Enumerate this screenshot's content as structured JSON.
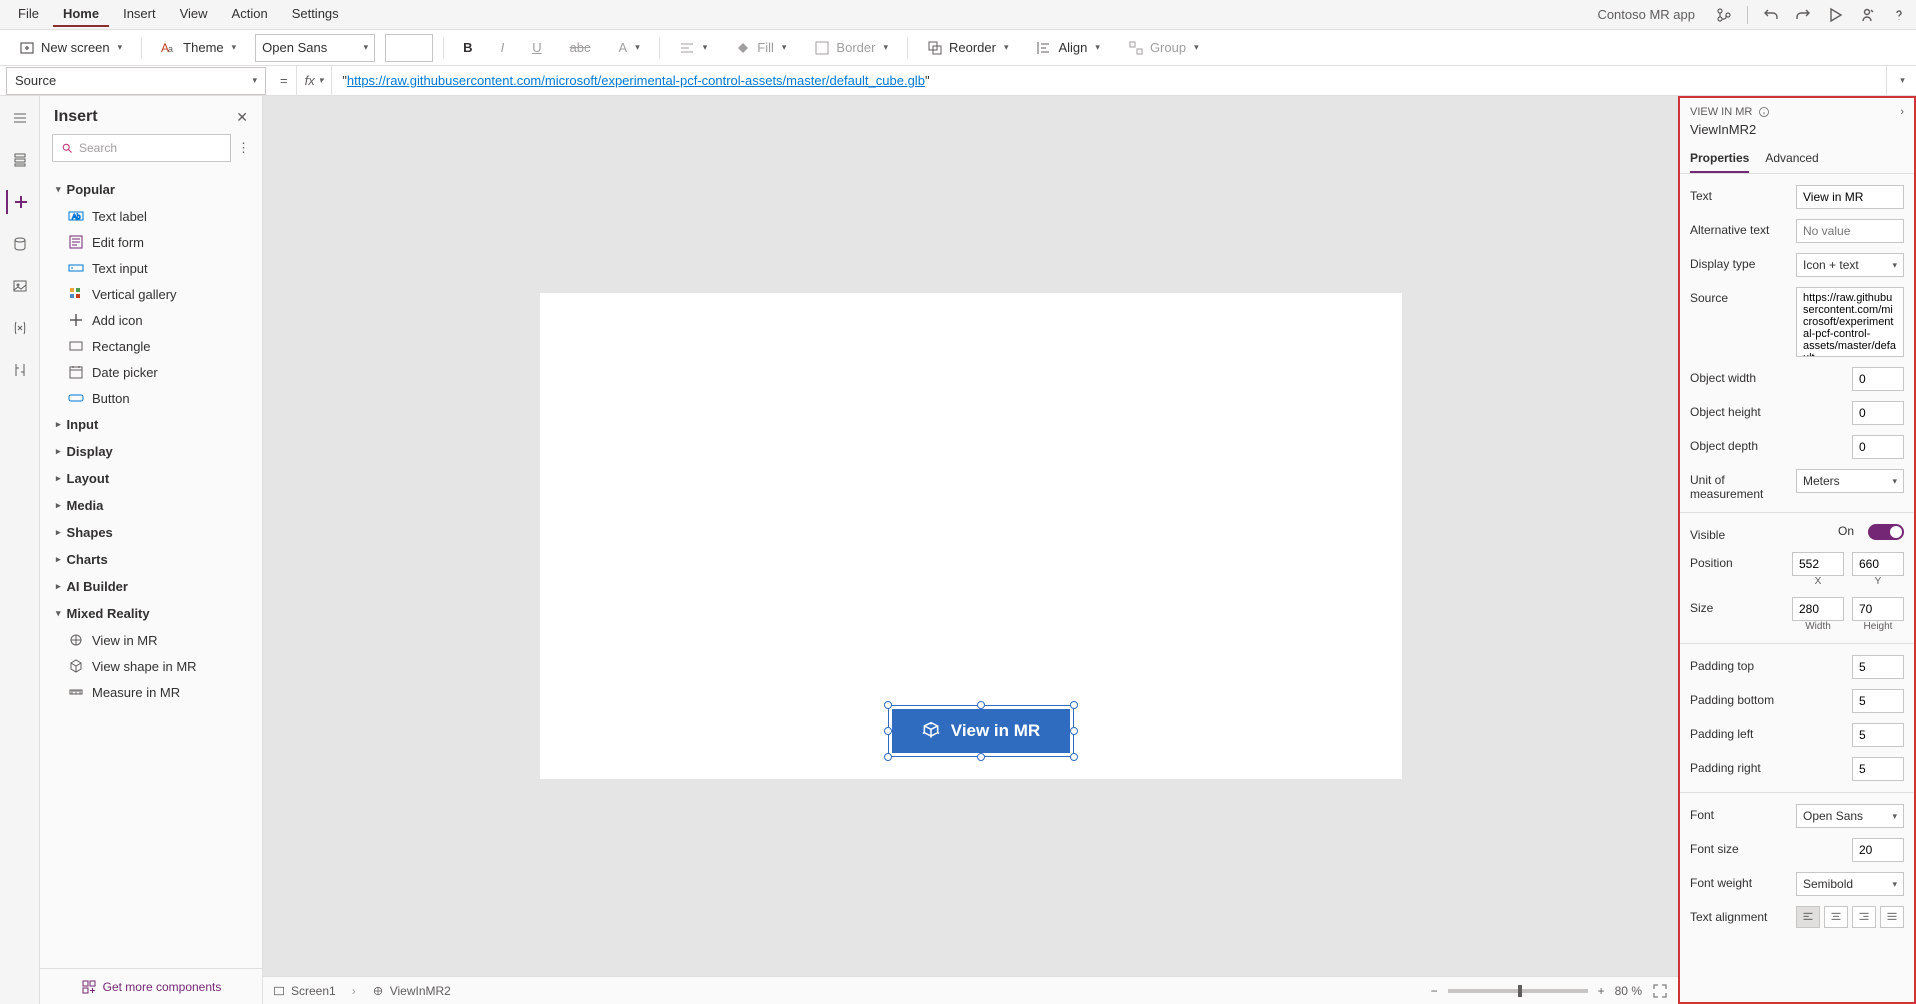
{
  "app_name": "Contoso MR app",
  "menu": [
    "File",
    "Home",
    "Insert",
    "View",
    "Action",
    "Settings"
  ],
  "menu_active": "Home",
  "ribbon": {
    "new_screen": "New screen",
    "theme": "Theme",
    "font": "Open Sans",
    "fill": "Fill",
    "border": "Border",
    "reorder": "Reorder",
    "align": "Align",
    "group": "Group"
  },
  "formula": {
    "property": "Source",
    "value_prefix": "\"",
    "value_link": "https://raw.githubusercontent.com/microsoft/experimental-pcf-control-assets/master/default_cube.glb",
    "value_suffix": "\""
  },
  "insert": {
    "title": "Insert",
    "search_placeholder": "Search",
    "get_more": "Get more components",
    "categories": {
      "popular": "Popular",
      "input": "Input",
      "display": "Display",
      "layout": "Layout",
      "media": "Media",
      "shapes": "Shapes",
      "charts": "Charts",
      "ai": "AI Builder",
      "mr": "Mixed Reality"
    },
    "popular_items": [
      "Text label",
      "Edit form",
      "Text input",
      "Vertical gallery",
      "Add icon",
      "Rectangle",
      "Date picker",
      "Button"
    ],
    "mr_items": [
      "View in MR",
      "View shape in MR",
      "Measure in MR"
    ]
  },
  "canvas_button_label": "View in MR",
  "breadcrumb": {
    "screen": "Screen1",
    "control": "ViewInMR2"
  },
  "zoom": {
    "value": "80",
    "unit": "%"
  },
  "props": {
    "kind": "VIEW IN MR",
    "name": "ViewInMR2",
    "tabs": [
      "Properties",
      "Advanced"
    ],
    "text": {
      "label": "Text",
      "value": "View in MR"
    },
    "alt": {
      "label": "Alternative text",
      "placeholder": "No value"
    },
    "display_type": {
      "label": "Display type",
      "value": "Icon + text"
    },
    "source": {
      "label": "Source",
      "value": "https://raw.githubusercontent.com/microsoft/experimental-pcf-control-assets/master/default_"
    },
    "obj_w": {
      "label": "Object width",
      "value": "0"
    },
    "obj_h": {
      "label": "Object height",
      "value": "0"
    },
    "obj_d": {
      "label": "Object depth",
      "value": "0"
    },
    "unit": {
      "label": "Unit of measurement",
      "value": "Meters"
    },
    "visible": {
      "label": "Visible",
      "value": "On"
    },
    "position": {
      "label": "Position",
      "x": "552",
      "y": "660",
      "xl": "X",
      "yl": "Y"
    },
    "size": {
      "label": "Size",
      "w": "280",
      "h": "70",
      "wl": "Width",
      "hl": "Height"
    },
    "pad_t": {
      "label": "Padding top",
      "value": "5"
    },
    "pad_b": {
      "label": "Padding bottom",
      "value": "5"
    },
    "pad_l": {
      "label": "Padding left",
      "value": "5"
    },
    "pad_r": {
      "label": "Padding right",
      "value": "5"
    },
    "font": {
      "label": "Font",
      "value": "Open Sans"
    },
    "font_size": {
      "label": "Font size",
      "value": "20"
    },
    "font_weight": {
      "label": "Font weight",
      "value": "Semibold"
    },
    "text_align": {
      "label": "Text alignment"
    }
  }
}
